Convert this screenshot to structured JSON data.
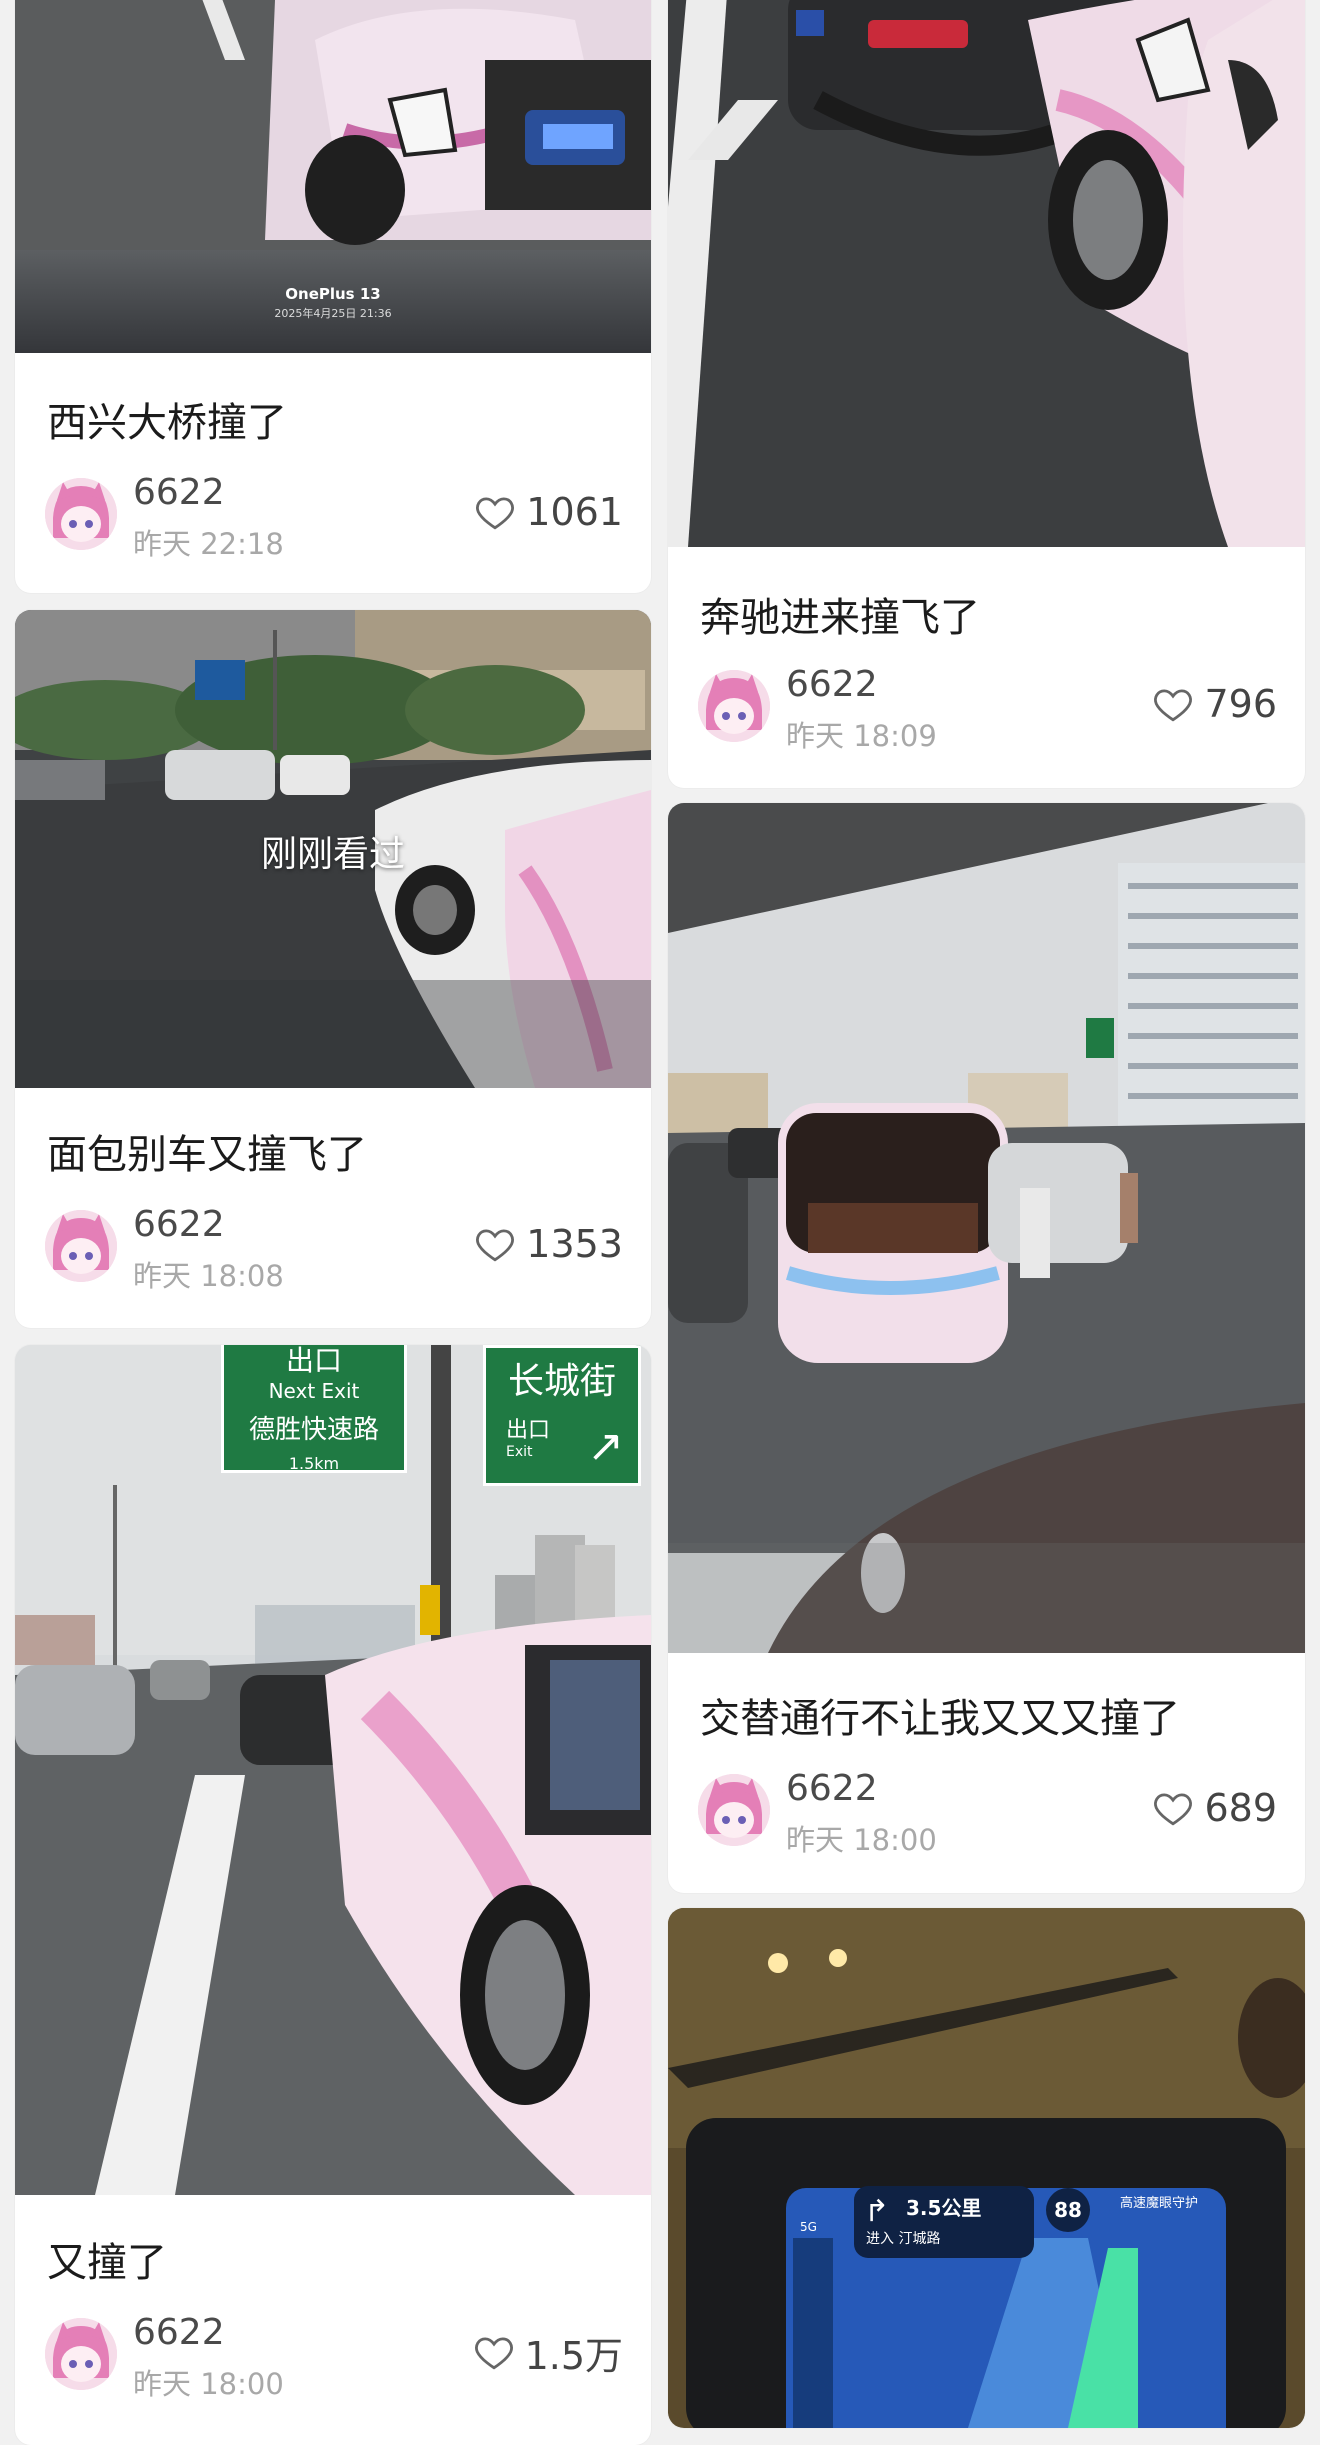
{
  "feed": {
    "left": [
      {
        "title": "西兴大桥撞了",
        "user": "6622",
        "time": "昨天 22:18",
        "likes": "1061",
        "watermark_brand": "OnePlus 13",
        "watermark_date": "2025年4月25日 21:36"
      },
      {
        "title": "面包别车又撞飞了",
        "user": "6622",
        "time": "昨天 18:08",
        "likes": "1353",
        "overlay": "刚刚看过"
      },
      {
        "title": "又撞了",
        "user": "6622",
        "time": "昨天 18:00",
        "likes": "1.5万",
        "sign_top": "出口",
        "sign_next": "Next Exit",
        "sign_road": "德胜快速路",
        "sign_dist": "1.5km",
        "sign2_name": "长城街",
        "sign2_exit": "出口",
        "sign2_exit_en": "Exit"
      }
    ],
    "right": [
      {
        "title": "奔驰进来撞飞了",
        "user": "6622",
        "time": "昨天 18:09",
        "likes": "796"
      },
      {
        "title": "交替通行不让我又又又撞了",
        "user": "6622",
        "time": "昨天 18:00",
        "likes": "689"
      },
      {
        "nav_distance": "3.5公里",
        "nav_road": "进入 汀城路",
        "nav_speed": "88",
        "nav_mode": "高速魔眼守护",
        "nav_net": "5G"
      }
    ]
  },
  "colors": {
    "background": "#f1f1f1",
    "card": "#ffffff",
    "title": "#1b1b1b",
    "meta": "#a8a8a8",
    "sign_green": "#1f7a43"
  },
  "icons": {
    "like": "heart-outline-icon",
    "avatar": "anime-avatar"
  }
}
